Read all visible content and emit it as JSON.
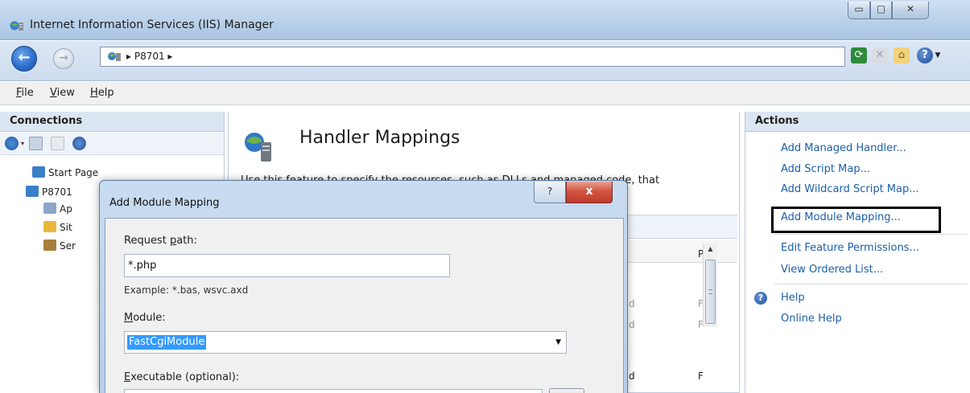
{
  "window": {
    "title": "Internet Information Services (IIS) Manager",
    "min_glyph": "▭",
    "max_glyph": "▢",
    "close_glyph": "✕"
  },
  "address": {
    "path": "▸  P8701  ▸",
    "back_glyph": "←",
    "forward_glyph": "→"
  },
  "menu": {
    "file_u": "F",
    "file_rest": "ile",
    "view_u": "V",
    "view_rest": "iew",
    "help_u": "H",
    "help_rest": "elp"
  },
  "connections": {
    "title": "Connections",
    "tree": [
      {
        "label": "Start Page"
      },
      {
        "label": "P8701"
      },
      {
        "label": "Ap"
      },
      {
        "label": "Sit"
      },
      {
        "label": "Ser"
      }
    ]
  },
  "center": {
    "title": "Handler Mappings",
    "description": "Use this feature to specify the resources, such as DLLs and managed code, that",
    "col_letters": {
      "head": "P",
      "row1": "F",
      "row2": "F",
      "row3": "F"
    },
    "grey_letters": [
      "d",
      "d",
      "d"
    ]
  },
  "actions": {
    "title": "Actions",
    "links": [
      "Add Managed Handler...",
      "Add Script Map...",
      "Add Wildcard Script Map...",
      "Add Module Mapping...",
      "Edit Feature Permissions...",
      "View Ordered List...",
      "Help",
      "Online Help"
    ]
  },
  "dialog": {
    "title": "Add Module Mapping",
    "help_glyph": "?",
    "close_glyph": "x",
    "request_path_label_pre": "Request ",
    "request_path_label_u": "p",
    "request_path_label_post": "ath:",
    "request_path_value": "*.php",
    "example": "Example: *.bas, wsvc.axd",
    "module_label_u": "M",
    "module_label_post": "odule:",
    "module_value": "FastCgiModule",
    "executable_label_u": "E",
    "executable_label_post": "xecutable (optional):"
  },
  "colors": {
    "link": "#1d5fa8",
    "selection": "#3399ff",
    "pane_header": "#dbe6f3"
  },
  "icons": [
    "iis-server-icon",
    "back-icon",
    "forward-icon",
    "refresh-icon",
    "stop-icon",
    "home-icon",
    "help-icon"
  ]
}
